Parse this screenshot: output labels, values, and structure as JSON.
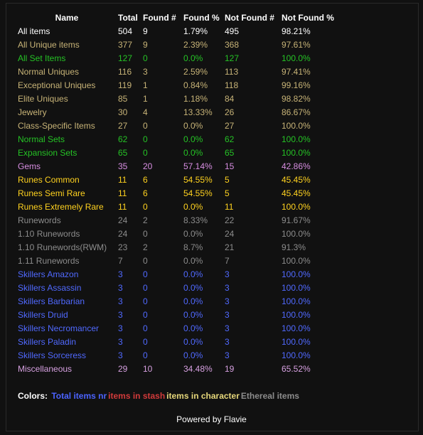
{
  "colors": {
    "white": "#ffffff",
    "unique": "#c7b377",
    "set": "#25c225",
    "gem": "#d88ee2",
    "rune": "#ffd21f",
    "runeword": "#8c8c8c",
    "skiller": "#5069ff",
    "misc": "#d6a0e0"
  },
  "table": {
    "headers": {
      "name": "Name",
      "total": "Total",
      "found": "Found #",
      "found_pct": "Found %",
      "not_found": "Not Found #",
      "not_found_pct": "Not Found %"
    },
    "rows": [
      {
        "name": "All items",
        "total": "504",
        "found": "9",
        "found_pct": "1.79%",
        "not_found": "495",
        "not_found_pct": "98.21%",
        "color": "white"
      },
      {
        "name": "All Unique items",
        "total": "377",
        "found": "9",
        "found_pct": "2.39%",
        "not_found": "368",
        "not_found_pct": "97.61%",
        "color": "unique"
      },
      {
        "name": "All Set Items",
        "total": "127",
        "found": "0",
        "found_pct": "0.0%",
        "not_found": "127",
        "not_found_pct": "100.0%",
        "color": "set"
      },
      {
        "name": "Normal Uniques",
        "total": "116",
        "found": "3",
        "found_pct": "2.59%",
        "not_found": "113",
        "not_found_pct": "97.41%",
        "color": "unique"
      },
      {
        "name": "Exceptional Uniques",
        "total": "119",
        "found": "1",
        "found_pct": "0.84%",
        "not_found": "118",
        "not_found_pct": "99.16%",
        "color": "unique"
      },
      {
        "name": "Elite Uniques",
        "total": "85",
        "found": "1",
        "found_pct": "1.18%",
        "not_found": "84",
        "not_found_pct": "98.82%",
        "color": "unique"
      },
      {
        "name": "Jewelry",
        "total": "30",
        "found": "4",
        "found_pct": "13.33%",
        "not_found": "26",
        "not_found_pct": "86.67%",
        "color": "unique"
      },
      {
        "name": "Class-Specific Items",
        "total": "27",
        "found": "0",
        "found_pct": "0.0%",
        "not_found": "27",
        "not_found_pct": "100.0%",
        "color": "unique"
      },
      {
        "name": "Normal Sets",
        "total": "62",
        "found": "0",
        "found_pct": "0.0%",
        "not_found": "62",
        "not_found_pct": "100.0%",
        "color": "set"
      },
      {
        "name": "Expansion Sets",
        "total": "65",
        "found": "0",
        "found_pct": "0.0%",
        "not_found": "65",
        "not_found_pct": "100.0%",
        "color": "set"
      },
      {
        "name": "Gems",
        "total": "35",
        "found": "20",
        "found_pct": "57.14%",
        "not_found": "15",
        "not_found_pct": "42.86%",
        "color": "gem"
      },
      {
        "name": "Runes Common",
        "total": "11",
        "found": "6",
        "found_pct": "54.55%",
        "not_found": "5",
        "not_found_pct": "45.45%",
        "color": "rune"
      },
      {
        "name": "Runes Semi Rare",
        "total": "11",
        "found": "6",
        "found_pct": "54.55%",
        "not_found": "5",
        "not_found_pct": "45.45%",
        "color": "rune"
      },
      {
        "name": "Runes Extremely Rare",
        "total": "11",
        "found": "0",
        "found_pct": "0.0%",
        "not_found": "11",
        "not_found_pct": "100.0%",
        "color": "rune"
      },
      {
        "name": "Runewords",
        "total": "24",
        "found": "2",
        "found_pct": "8.33%",
        "not_found": "22",
        "not_found_pct": "91.67%",
        "color": "runeword"
      },
      {
        "name": "1.10 Runewords",
        "total": "24",
        "found": "0",
        "found_pct": "0.0%",
        "not_found": "24",
        "not_found_pct": "100.0%",
        "color": "runeword"
      },
      {
        "name": "1.10 Runewords(RWM)",
        "total": "23",
        "found": "2",
        "found_pct": "8.7%",
        "not_found": "21",
        "not_found_pct": "91.3%",
        "color": "runeword"
      },
      {
        "name": "1.11 Runewords",
        "total": "7",
        "found": "0",
        "found_pct": "0.0%",
        "not_found": "7",
        "not_found_pct": "100.0%",
        "color": "runeword"
      },
      {
        "name": "Skillers Amazon",
        "total": "3",
        "found": "0",
        "found_pct": "0.0%",
        "not_found": "3",
        "not_found_pct": "100.0%",
        "color": "skiller"
      },
      {
        "name": "Skillers Assassin",
        "total": "3",
        "found": "0",
        "found_pct": "0.0%",
        "not_found": "3",
        "not_found_pct": "100.0%",
        "color": "skiller"
      },
      {
        "name": "Skillers Barbarian",
        "total": "3",
        "found": "0",
        "found_pct": "0.0%",
        "not_found": "3",
        "not_found_pct": "100.0%",
        "color": "skiller"
      },
      {
        "name": "Skillers Druid",
        "total": "3",
        "found": "0",
        "found_pct": "0.0%",
        "not_found": "3",
        "not_found_pct": "100.0%",
        "color": "skiller"
      },
      {
        "name": "Skillers Necromancer",
        "total": "3",
        "found": "0",
        "found_pct": "0.0%",
        "not_found": "3",
        "not_found_pct": "100.0%",
        "color": "skiller"
      },
      {
        "name": "Skillers Paladin",
        "total": "3",
        "found": "0",
        "found_pct": "0.0%",
        "not_found": "3",
        "not_found_pct": "100.0%",
        "color": "skiller"
      },
      {
        "name": "Skillers Sorceress",
        "total": "3",
        "found": "0",
        "found_pct": "0.0%",
        "not_found": "3",
        "not_found_pct": "100.0%",
        "color": "skiller"
      },
      {
        "name": "Miscellaneous",
        "total": "29",
        "found": "10",
        "found_pct": "34.48%",
        "not_found": "19",
        "not_found_pct": "65.52%",
        "color": "misc"
      }
    ]
  },
  "legend": {
    "label": "Colors:",
    "items": [
      {
        "text": "Total items nr",
        "color": "#4b63ff"
      },
      {
        "text": "items in stash",
        "color": "#d23a3a"
      },
      {
        "text": "items in character",
        "color": "#e6d77a"
      },
      {
        "text": "Ethereal items",
        "color": "#8c8c8c"
      }
    ]
  },
  "footer": {
    "text": "Powered by Flavie"
  }
}
